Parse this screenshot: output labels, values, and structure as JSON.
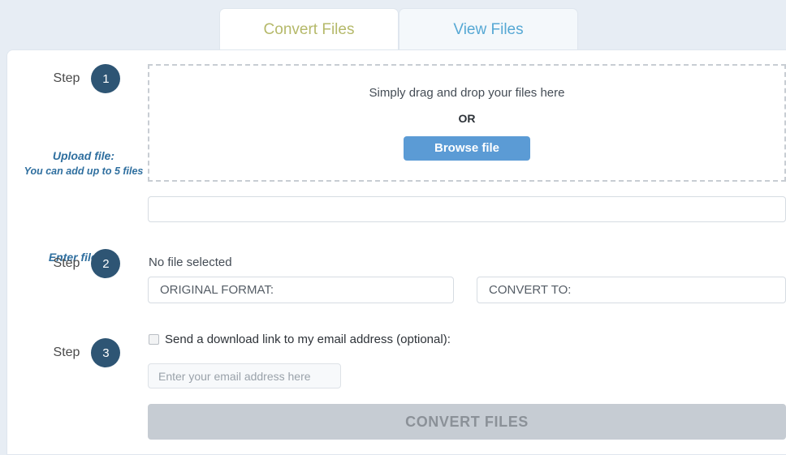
{
  "tabs": [
    {
      "label": "Convert Files",
      "active": true
    },
    {
      "label": "View Files",
      "active": false
    }
  ],
  "steps": {
    "word": "Step",
    "one": "1",
    "two": "2",
    "three": "3"
  },
  "step1": {
    "upload_title": "Upload file:",
    "upload_hint": "You can add up to 5 files",
    "dropzone_text": "Simply drag and drop your files here",
    "or": "OR",
    "browse_label": "Browse file",
    "url_label": "Enter file url:",
    "url_value": "",
    "url_placeholder": ""
  },
  "step2": {
    "no_file": "No file selected",
    "original_format": "ORIGINAL FORMAT:",
    "convert_to": "CONVERT TO:"
  },
  "step3": {
    "email_option": "Send a download link to my email address (optional):",
    "email_placeholder": "Enter your email address here",
    "email_value": "",
    "checked": false
  },
  "submit": {
    "label": "CONVERT FILES",
    "disabled": true
  },
  "colors": {
    "page_bg": "#e7edf4",
    "card_bg": "#ffffff",
    "accent_blue": "#5b9bd5",
    "step_badge": "#2e5574",
    "label_blue": "#2f6f9f",
    "tab_active_text": "#b5b96a",
    "tab_inactive_text": "#56a8d4",
    "submit_disabled": "#c6ccd3"
  }
}
